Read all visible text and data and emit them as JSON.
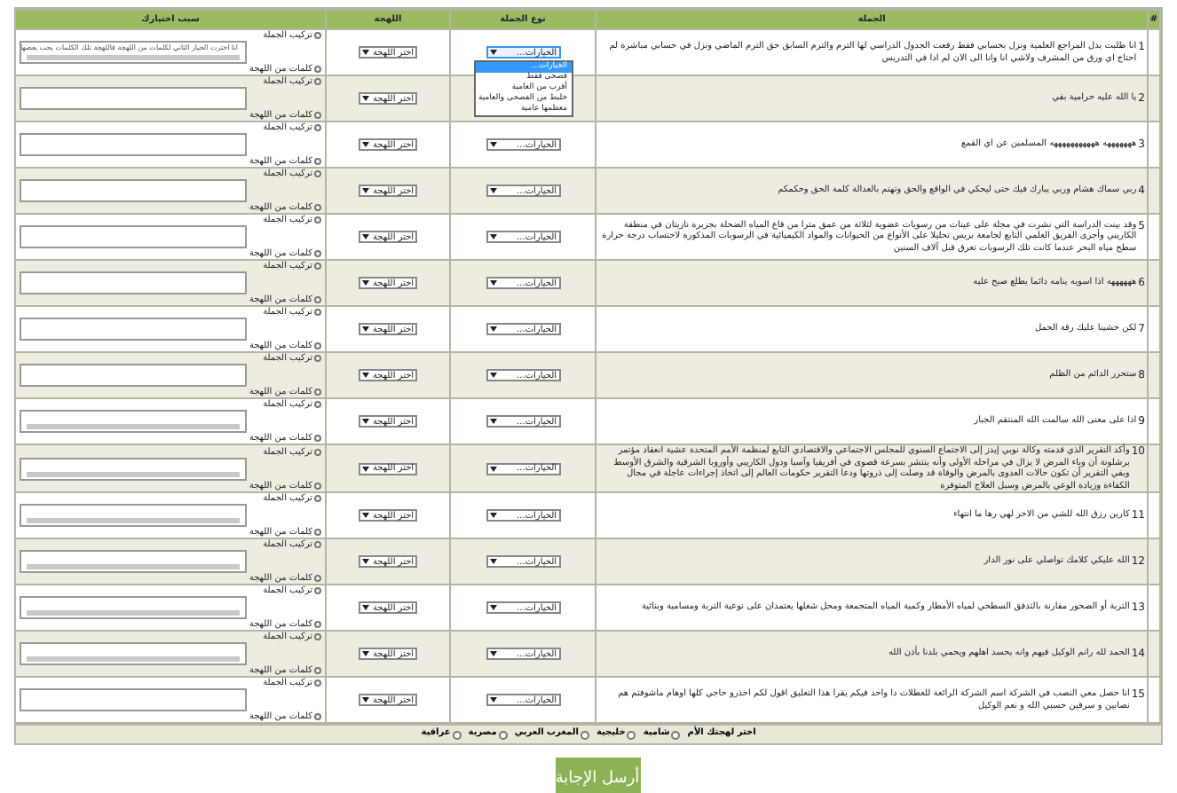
{
  "table": {
    "columns": [
      "#",
      "الجملة",
      "نوع الجملة",
      "اللهجة",
      "سبب اختيارك"
    ],
    "rows": [
      {
        "number": "1",
        "sentence": "انا طلبت بدل المراجع العلمية ونزل بحسابي فقط رفعت الجدول الدراسي لها الترم والترم السابق حق الترم الماضي ونزل في حسابي مباشرة لم احتاج اي ورق من المشرف ولاشي انا وانا الى الان لم ادا في التدريس",
        "type_select": {
          "value": "الخيارات...",
          "expanded": true,
          "options": [
            {
              "label": "الخيارات...",
              "selected": true
            },
            {
              "label": "فصحى فقط",
              "selected": false
            },
            {
              "label": "أقرب من العامية",
              "selected": false
            },
            {
              "label": "خليط من الفصحى والعامية",
              "selected": false
            },
            {
              "label": "معظمها عامية",
              "selected": false
            }
          ]
        },
        "dialect_select": "اختر اللهجة",
        "reason_top": {
          "label": "تركيب الجملة",
          "checked": false
        },
        "reason_text": "انا اخترت الخيار الثاني لكلمات من اللهجة فاللهجة تلك الكلمات يحب بعضها",
        "reason_bottom": {
          "label": "كلمات من اللهجة",
          "checked": false
        },
        "scrollbar": true
      },
      {
        "number": "2",
        "sentence": "يا الله عليه حرامية بقي",
        "dialect_select": "اختر اللهجة",
        "reason_top": {
          "label": "تركيب الجملة",
          "checked": false
        },
        "reason_bottom": {
          "label": "كلمات من اللهجة",
          "checked": false
        },
        "scrollbar": false
      },
      {
        "number": "3",
        "sentence": "هههههههه هههههههههههه المسلمين عن اي القمع",
        "type_select": {
          "value": "الخيارات...",
          "expanded": false
        },
        "dialect_select": "اختر اللهجة",
        "reason_top": {
          "label": "تركيب الجملة",
          "checked": false
        },
        "reason_bottom": {
          "label": "كلمات من اللهجة",
          "checked": false
        },
        "scrollbar": false
      },
      {
        "number": "4",
        "sentence": "ربي سماك هشام وربي يبارك فيك حتى ليحكي في الواقع والحق وتهتم بالعدالة كلمة الحق وحكمكم",
        "type_select": {
          "value": "الخيارات...",
          "expanded": false
        },
        "dialect_select": "اختر اللهجة",
        "reason_top": {
          "label": "تركيب الجملة",
          "checked": false
        },
        "reason_bottom": {
          "label": "كلمات من اللهجة",
          "checked": false
        },
        "scrollbar": false
      },
      {
        "number": "5",
        "sentence": "وقد بينت الدراسة التي نشرت في مجلة على عينات من رسوبات عضوية لثلاثة من عمق مترا من قاع المياه الضحلة بجزيرة نازيتان في منطقة الكاريبي وأجرى الفريق العلمي التابع لجامعة بريس تحليلا على الأنواع من الحيوانات والمواد الكيميائية في الرسوبات المذكورة لاحتساب درجة حرارة سطح مياه البحر عندما كانت تلك الرسوبات تغرق قبل آلاف السنين",
        "type_select": {
          "value": "الخيارات...",
          "expanded": false
        },
        "dialect_select": "اختر اللهجة",
        "reason_top": {
          "label": "تركيب الجملة",
          "checked": false
        },
        "reason_bottom": {
          "label": "كلمات من اللهجة",
          "checked": false
        },
        "scrollbar": false
      },
      {
        "number": "6",
        "sentence": "ههههههه اذا اسويه ينامه دائما يطلع صبح عليه",
        "type_select": {
          "value": "الخيارات...",
          "expanded": false
        },
        "dialect_select": "اختر اللهجة",
        "reason_top": {
          "label": "تركيب الجملة",
          "checked": false
        },
        "reason_bottom": {
          "label": "كلمات من اللهجة",
          "checked": false
        },
        "scrollbar": false
      },
      {
        "number": "7",
        "sentence": "لكن خشينا عليك رقة الحمل",
        "type_select": {
          "value": "الخيارات...",
          "expanded": false
        },
        "dialect_select": "اختر اللهجة",
        "reason_top": {
          "label": "تركيب الجملة",
          "checked": false
        },
        "reason_bottom": {
          "label": "كلمات من اللهجة",
          "checked": false
        },
        "scrollbar": false
      },
      {
        "number": "8",
        "sentence": "ستحرر الدائم من الظلم",
        "type_select": {
          "value": "الخيارات...",
          "expanded": false
        },
        "dialect_select": "اختر اللهجة",
        "reason_top": {
          "label": "تركيب الجملة",
          "checked": false
        },
        "reason_bottom": {
          "label": "كلمات من اللهجة",
          "checked": false
        },
        "scrollbar": false
      },
      {
        "number": "9",
        "sentence": "اذا على معنى الله سالمت الله المنتقم الجبار",
        "type_select": {
          "value": "الخيارات...",
          "expanded": false
        },
        "dialect_select": "اختر اللهجة",
        "reason_top": {
          "label": "تركيب الجملة",
          "checked": false
        },
        "reason_bottom": {
          "label": "كلمات من اللهجة",
          "checked": false
        },
        "scrollbar": true
      },
      {
        "number": "10",
        "sentence": "وأكد التقرير الذي قدمته وكالة نوبي إيدز إلى الاجتماع السنوي للمجلس الاجتماعي والاقتصادي التابع لمنظمة الأمم المتحدة عشية انعقاد مؤتمر برشلونة أن وباء المرض لا يزال في مراحله الأولى وأنه ينتشر بسرعة قصوى في أفريقيا وآسيا ودول الكاريبي وأوروبا الشرقية والشرق الأوسط وبقي التقرير أن تكون حالات العدوى بالمرض والوفاة قد وصلت إلى ذروتها ودعا التقرير حكومات العالم إلى اتخاذ إجراءات عاجلة في مجال الكفاءة وزيادة الوعي بالمرض وسبل العلاج المتوفرة",
        "type_select": {
          "value": "الخيارات...",
          "expanded": false
        },
        "dialect_select": "اختر اللهجة",
        "reason_top": {
          "label": "تركيب الجملة",
          "checked": false
        },
        "reason_bottom": {
          "label": "كلمات من اللهجة",
          "checked": false
        },
        "scrollbar": true
      },
      {
        "number": "11",
        "sentence": "كارين رزق الله للشي من الاخر لهي رها ما انتهاء",
        "type_select": {
          "value": "الخيارات...",
          "expanded": false
        },
        "dialect_select": "اختر اللهجة",
        "reason_top": {
          "label": "تركيب الجملة",
          "checked": false
        },
        "reason_bottom": {
          "label": "كلمات من اللهجة",
          "checked": false
        },
        "scrollbar": true
      },
      {
        "number": "12",
        "sentence": "الله عليكي كلامك تواصلي على نور الدار",
        "type_select": {
          "value": "الخيارات...",
          "expanded": false
        },
        "dialect_select": "اختر اللهجة",
        "reason_top": {
          "label": "تركيب الجملة",
          "checked": false
        },
        "reason_bottom": {
          "label": "كلمات من اللهجة",
          "checked": false
        },
        "scrollbar": true
      },
      {
        "number": "13",
        "sentence": "التربة أو الصخور مقارنة بالتدفق السطحي لمياه الأمطار وكمية المياه المتجمعة ومحل شغلها يعتمدان على نوعية التربة ومسامية وبنائية",
        "type_select": {
          "value": "الخيارات...",
          "expanded": false
        },
        "dialect_select": "اختر اللهجة",
        "reason_top": {
          "label": "تركيب الجملة",
          "checked": false
        },
        "reason_bottom": {
          "label": "كلمات من اللهجة",
          "checked": false
        },
        "scrollbar": true
      },
      {
        "number": "14",
        "sentence": "الحمد لله رانم الوكيل فيهم وانه يحسد اهلهم ويحمي بلدنا بأذن الله",
        "type_select": {
          "value": "الخيارات...",
          "expanded": false
        },
        "dialect_select": "اختر اللهجة",
        "reason_top": {
          "label": "تركيب الجملة",
          "checked": false
        },
        "reason_bottom": {
          "label": "كلمات من اللهجة",
          "checked": false
        },
        "scrollbar": true
      },
      {
        "number": "15",
        "sentence": "انا حصل معي النصب في الشركة اسم الشركة الرائعة للعطلات دا واحد فيكم يقرا هذا التعليق اقول لكم احذرو حاجي كلها اوهام ماشوفتم هم نصابين و سرقين حسبي الله و نعم الوكيل",
        "type_select": {
          "value": "الخيارات...",
          "expanded": false
        },
        "dialect_select": "اختر اللهجة",
        "reason_top": {
          "label": "تركيب الجملة",
          "checked": false
        },
        "reason_bottom": {
          "label": "كلمات من اللهجة",
          "checked": false
        },
        "scrollbar": false
      }
    ]
  },
  "native_dialect": {
    "label": "اختر لهجتك الأم",
    "options": [
      {
        "label": "شامية",
        "selected": false
      },
      {
        "label": "خليجية",
        "selected": false
      },
      {
        "label": "المغرب العربي",
        "selected": false
      },
      {
        "label": "مصرية",
        "selected": false
      },
      {
        "label": "عراقية",
        "selected": false
      }
    ]
  },
  "submit_button": "أرسل الإجابة"
}
